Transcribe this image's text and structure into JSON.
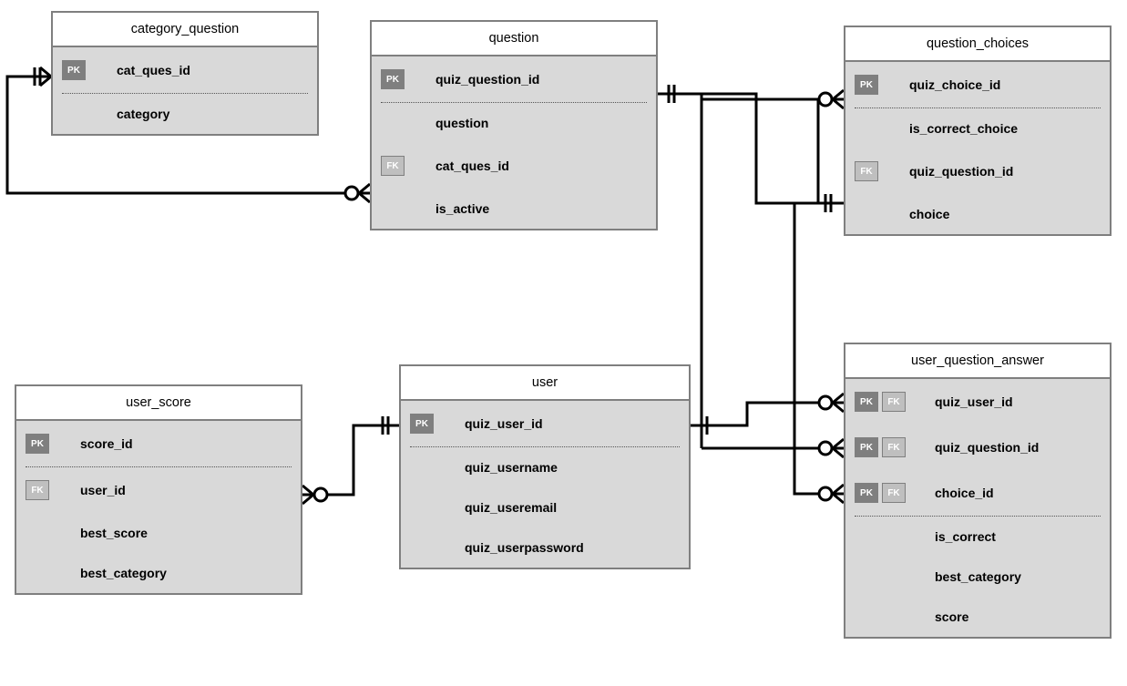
{
  "keys": {
    "pk": "PK",
    "fk": "FK"
  },
  "entities": {
    "category_question": {
      "title": "category_question",
      "pk": "cat_ques_id",
      "attrs": [
        "category"
      ]
    },
    "question": {
      "title": "question",
      "pk": "quiz_question_id",
      "attrs": {
        "a1": "question",
        "fk": "cat_ques_id",
        "a3": "is_active"
      }
    },
    "question_choices": {
      "title": "question_choices",
      "pk": "quiz_choice_id",
      "attrs": {
        "a1": "is_correct_choice",
        "fk": "quiz_question_id",
        "a3": "choice"
      }
    },
    "user_score": {
      "title": "user_score",
      "pk": "score_id",
      "attrs": {
        "fk": "user_id",
        "a2": "best_score",
        "a3": "best_category"
      }
    },
    "user": {
      "title": "user",
      "pk": "quiz_user_id",
      "attrs": {
        "a1": "quiz_username",
        "a2": "quiz_useremail",
        "a3": "quiz_userpassword"
      }
    },
    "user_question_answer": {
      "title": "user_question_answer",
      "pk1": "quiz_user_id",
      "pk2": "quiz_question_id",
      "pk3": "choice_id",
      "attrs": {
        "a1": "is_correct",
        "a2": "best_category",
        "a3": "score"
      }
    }
  }
}
